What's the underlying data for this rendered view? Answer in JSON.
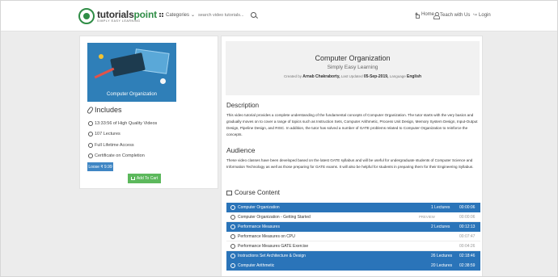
{
  "header": {
    "logo_name_a": "tutorials",
    "logo_name_b": "point",
    "logo_tagline": "SIMPLY EASY LEARNING",
    "categories_label": "Categories",
    "search_placeholder": "search video tutorials...",
    "nav": {
      "home": "Home",
      "teach": "Teach with Us",
      "login": "Login"
    }
  },
  "course_card": {
    "thumb_caption": "Computer Organization",
    "includes_title": "Includes",
    "includes": [
      "13:33:56 of High Quality Videos",
      "107  Lectures",
      "Full Lifetime Access",
      "Certificate on Completion"
    ],
    "price_label": "Loose ₹ 9.99",
    "cart_label": "Add To Cart"
  },
  "hero": {
    "title": "Computer Organization",
    "subtitle": "Simply Easy Learning",
    "created_by_label": "Created by",
    "author": "Arnab Chakraborty,",
    "updated_label": "Last Updated",
    "updated": "05-Sep-2019,",
    "language_label": "Language",
    "language": "English"
  },
  "description": {
    "heading": "Description",
    "text": "This video tutorial provides a complete understanding of the fundamental concepts of Computer Organization. The tutor starts with the very basics and gradually moves on to cover a range of topics such as Instruction Sets, Computer Arithmetic, Process Unit Design, Memory System Design, Input-Output Design, Pipeline Design, and RISC. In addition, the tutor has solved a number of GATE problems related to Computer Organization to reinforce the concepts."
  },
  "audience": {
    "heading": "Audience",
    "text": "These video classes have been developed based on the latest GATE syllabus and will be useful for undergraduate students of Computer Science and Information Technology as well as those preparing for GATE exams. It will also be helpful for students in preparing them for their Engineering Syllabus."
  },
  "content": {
    "heading": "Course Content",
    "preview_label": "PREVIEW",
    "rows": [
      {
        "type": "section",
        "name": "Computer Organization",
        "count": "1 Lectures",
        "duration": "00:00:06"
      },
      {
        "type": "lecture",
        "name": "Computer Organization - Getting Started",
        "preview": true,
        "duration": "00:00:06"
      },
      {
        "type": "section",
        "name": "Performance Measures",
        "count": "2 Lectures",
        "duration": "00:12:13"
      },
      {
        "type": "lecture",
        "name": "Performance Measures on CPU",
        "preview": false,
        "duration": "00:07:47"
      },
      {
        "type": "lecture",
        "name": "Performance Measures GATE Exercise",
        "preview": false,
        "duration": "00:04:26"
      },
      {
        "type": "section",
        "name": "Instructions Set Architecture & Design",
        "count": "26 Lectures",
        "duration": "02:18:46"
      },
      {
        "type": "section",
        "name": "Computer Arithmetic",
        "count": "20 Lectures",
        "duration": "02:38:59"
      }
    ]
  }
}
